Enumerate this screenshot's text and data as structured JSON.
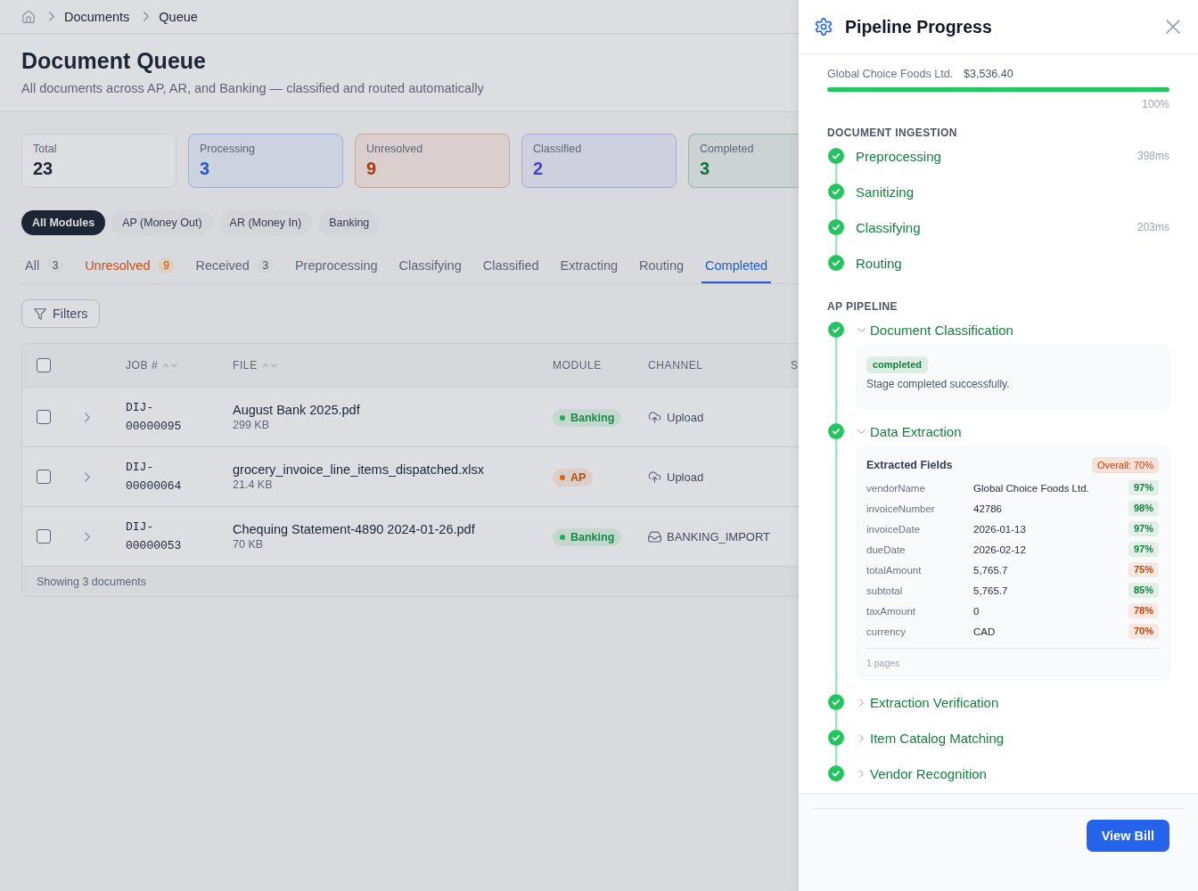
{
  "breadcrumb": [
    "Documents",
    "Queue"
  ],
  "page": {
    "title": "Document Queue",
    "subtitle": "All documents across AP, AR, and Banking — classified and routed automatically"
  },
  "stats": [
    {
      "label": "Total",
      "value": "23",
      "kind": "plain",
      "color": "#1d2635"
    },
    {
      "label": "Processing",
      "value": "3",
      "kind": "tinted",
      "color": "#2258d0"
    },
    {
      "label": "Unresolved",
      "value": "9",
      "kind": "tinted",
      "color": "#a93b10"
    },
    {
      "label": "Classified",
      "value": "2",
      "kind": "tinted",
      "color": "#463fcb"
    },
    {
      "label": "Completed",
      "value": "3",
      "kind": "tinted",
      "color": "#14713a"
    }
  ],
  "module_filters": [
    {
      "label": "All Modules",
      "selected": true
    },
    {
      "label": "AP (Money Out)",
      "selected": false
    },
    {
      "label": "AR (Money In)",
      "selected": false
    },
    {
      "label": "Banking",
      "selected": false
    }
  ],
  "status_tabs": [
    {
      "label": "All",
      "count": "3",
      "kind": "normal",
      "selected": false
    },
    {
      "label": "Unresolved",
      "count": "9",
      "kind": "warning",
      "selected": false
    },
    {
      "label": "Received",
      "count": "3",
      "kind": "normal",
      "selected": false
    },
    {
      "label": "Preprocessing",
      "kind": "normal",
      "selected": false
    },
    {
      "label": "Classifying",
      "kind": "normal",
      "selected": false
    },
    {
      "label": "Classified",
      "kind": "normal",
      "selected": false
    },
    {
      "label": "Extracting",
      "kind": "normal",
      "selected": false
    },
    {
      "label": "Routing",
      "kind": "normal",
      "selected": false
    },
    {
      "label": "Completed",
      "kind": "normal",
      "selected": true
    }
  ],
  "filters_button": "Filters",
  "table": {
    "select_all": {
      "checked": false
    },
    "columns": [
      {
        "label": "JOB #",
        "sortable": true
      },
      {
        "label": "FILE",
        "sortable": true
      },
      {
        "label": "MODULE",
        "sortable": false
      },
      {
        "label": "CHANNEL",
        "sortable": false
      },
      {
        "label": "S",
        "sortable": false
      }
    ],
    "rows": [
      {
        "checked": false,
        "expanded": false,
        "job": "DIJ-00000095",
        "file": "August Bank 2025.pdf",
        "size": "299 KB",
        "module": {
          "label": "Banking",
          "color": "#1fad57"
        },
        "channel": {
          "label": "Upload",
          "kind": "upload"
        }
      },
      {
        "checked": false,
        "expanded": false,
        "job": "DIJ-00000064",
        "file": "grocery_invoice_line_items_dispatched.xlsx",
        "size": "21.4 KB",
        "module": {
          "label": "AP",
          "color": "#d86619"
        },
        "channel": {
          "label": "Upload",
          "kind": "upload"
        }
      },
      {
        "checked": false,
        "expanded": false,
        "job": "DIJ-00000053",
        "file": "Chequing Statement-4890 2024-01-26.pdf",
        "size": "70 KB",
        "module": {
          "label": "Banking",
          "color": "#1fad57"
        },
        "channel": {
          "label": "BANKING_IMPORT",
          "kind": "import"
        }
      }
    ],
    "footer": "Showing 3 documents"
  },
  "drawer": {
    "title": "Pipeline Progress",
    "summary": {
      "vendor": "Global Choice Foods Ltd.",
      "amount": "$3,536.40"
    },
    "progress": {
      "level": 1,
      "reading": "100%"
    },
    "sections": [
      {
        "title": "DOCUMENT INGESTION",
        "kind": "steps",
        "steps": [
          {
            "label": "Preprocessing",
            "duration": "398ms",
            "done": true
          },
          {
            "label": "Sanitizing",
            "done": true
          },
          {
            "label": "Classifying",
            "duration": "203ms",
            "done": true
          },
          {
            "label": "Routing",
            "done": true
          }
        ]
      },
      {
        "title": "AP PIPELINE",
        "kind": "stages",
        "steps": [
          {
            "label": "Document Classification",
            "done": true,
            "expanded": true,
            "detail": {
              "kind": "status",
              "badge": {
                "text": "completed",
                "color": "#15803d"
              },
              "message": "Stage completed successfully."
            }
          },
          {
            "label": "Data Extraction",
            "done": true,
            "expanded": true,
            "detail": {
              "kind": "fields",
              "title": "Extracted Fields",
              "overall": {
                "text": "Overall: 70%",
                "color": "#c2410c"
              },
              "fields": [
                {
                  "name": "vendorName",
                  "value": "Global Choice Foods Ltd.",
                  "confidence": "97%",
                  "color": "#15803d"
                },
                {
                  "name": "invoiceNumber",
                  "value": "42786",
                  "confidence": "98%",
                  "color": "#15803d"
                },
                {
                  "name": "invoiceDate",
                  "value": "2026-01-13",
                  "confidence": "97%",
                  "color": "#15803d"
                },
                {
                  "name": "dueDate",
                  "value": "2026-02-12",
                  "confidence": "97%",
                  "color": "#15803d"
                },
                {
                  "name": "totalAmount",
                  "value": "5,765.7",
                  "confidence": "75%",
                  "color": "#c2410c"
                },
                {
                  "name": "subtotal",
                  "value": "5,765.7",
                  "confidence": "85%",
                  "color": "#15803d"
                },
                {
                  "name": "taxAmount",
                  "value": "0",
                  "confidence": "78%",
                  "color": "#c2410c"
                },
                {
                  "name": "currency",
                  "value": "CAD",
                  "confidence": "70%",
                  "color": "#c2410c"
                }
              ],
              "pages": "1 pages"
            }
          },
          {
            "label": "Extraction Verification",
            "done": true,
            "expanded": false
          },
          {
            "label": "Item Catalog Matching",
            "done": true,
            "expanded": false
          },
          {
            "label": "Vendor Recognition",
            "done": true,
            "expanded": false
          }
        ]
      }
    ],
    "action_button": "View Bill"
  }
}
